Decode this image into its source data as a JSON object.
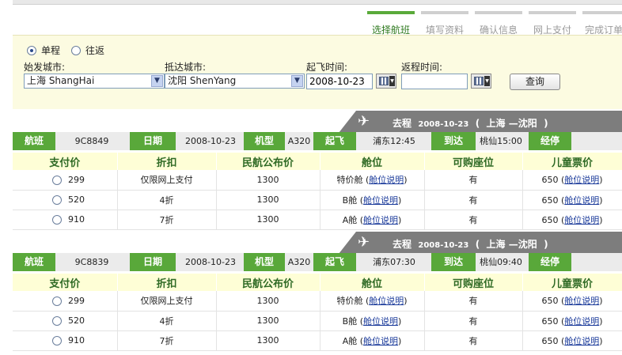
{
  "steps": [
    "选择航班",
    "填写资料",
    "确认信息",
    "网上支付",
    "完成订单"
  ],
  "search": {
    "one_way_label": "单程",
    "round_trip_label": "往返",
    "origin_label": "始发城市:",
    "origin_value": "上海 ShangHai",
    "destination_label": "抵达城市:",
    "destination_value": "沈阳 ShenYang",
    "depart_label": "起飞时间:",
    "depart_value": "2008-10-23",
    "return_label": "返程时间:",
    "return_value": "",
    "query_button": "查询"
  },
  "flights": [
    {
      "route": {
        "trip": "去程",
        "date": "2008-10-23",
        "open": "(",
        "from": "上海",
        "dash": "—",
        "to": "沈阳",
        "close": ")"
      },
      "bar": {
        "flight_label": "航班",
        "flight_no": "9C8849",
        "date_label": "日期",
        "date": "2008-10-23",
        "model_label": "机型",
        "model": "A320",
        "depart_label": "起飞",
        "depart": "浦东12:45",
        "arrive_label": "到达",
        "arrive": "桃仙15:00",
        "stop_label": "经停"
      },
      "headers": [
        "支付价",
        "折扣",
        "民航公布价",
        "舱位",
        "可购座位",
        "儿童票价"
      ],
      "rows": [
        {
          "price": "299",
          "discount": "仅限网上支付",
          "public_price": "1300",
          "cabin": "特价舱",
          "seats": "有",
          "child": "650"
        },
        {
          "price": "520",
          "discount": "4折",
          "public_price": "1300",
          "cabin": "B舱",
          "seats": "有",
          "child": "650"
        },
        {
          "price": "910",
          "discount": "7折",
          "public_price": "1300",
          "cabin": "A舱",
          "seats": "有",
          "child": "650"
        }
      ]
    },
    {
      "route": {
        "trip": "去程",
        "date": "2008-10-23",
        "open": "(",
        "from": "上海",
        "dash": "—",
        "to": "沈阳",
        "close": ")"
      },
      "bar": {
        "flight_label": "航班",
        "flight_no": "9C8839",
        "date_label": "日期",
        "date": "2008-10-23",
        "model_label": "机型",
        "model": "A320",
        "depart_label": "起飞",
        "depart": "浦东07:30",
        "arrive_label": "到达",
        "arrive": "桃仙09:40",
        "stop_label": "经停"
      },
      "headers": [
        "支付价",
        "折扣",
        "民航公布价",
        "舱位",
        "可购座位",
        "儿童票价"
      ],
      "rows": [
        {
          "price": "299",
          "discount": "仅限网上支付",
          "public_price": "1300",
          "cabin": "特价舱",
          "seats": "有",
          "child": "650"
        },
        {
          "price": "520",
          "discount": "4折",
          "public_price": "1300",
          "cabin": "B舱",
          "seats": "有",
          "child": "650"
        },
        {
          "price": "910",
          "discount": "7折",
          "public_price": "1300",
          "cabin": "A舱",
          "seats": "有",
          "child": "650"
        }
      ]
    }
  ],
  "cabin_link_text": "舱位说明",
  "paren_open": "(",
  "paren_close": ")",
  "icons": {
    "plane": "plane-icon",
    "calendar": "calendar-icon",
    "dropdown": "chevron-down-icon"
  },
  "colors": {
    "green": "#59a83a",
    "banner_gray": "#7d7d7d",
    "panel_bg": "#fcfbe1",
    "header_bg": "#fefed6",
    "header_text": "#2f6a25"
  }
}
